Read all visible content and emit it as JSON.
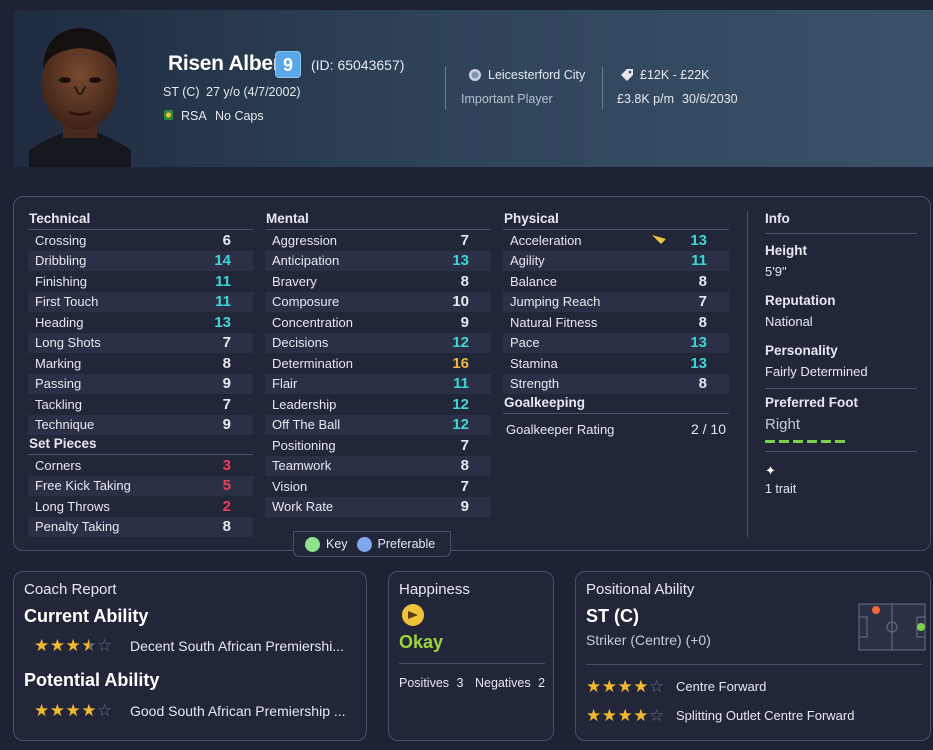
{
  "player": {
    "name": "Risen Albert",
    "number": "9",
    "id_text": "(ID: 65043657)",
    "position": "ST (C)",
    "age_dob": "27 y/o (4/7/2002)",
    "nation": "RSA",
    "caps": "No Caps",
    "club": "Leicesterford City",
    "squad_status": "Important Player",
    "value": "£12K - £22K",
    "wage": "£3.8K p/m",
    "contract_end": "30/6/2030"
  },
  "technical": {
    "title": "Technical",
    "rows": [
      {
        "label": "Crossing",
        "value": "6",
        "tone": "norm"
      },
      {
        "label": "Dribbling",
        "value": "14",
        "tone": "hi"
      },
      {
        "label": "Finishing",
        "value": "11",
        "tone": "hi"
      },
      {
        "label": "First Touch",
        "value": "11",
        "tone": "hi"
      },
      {
        "label": "Heading",
        "value": "13",
        "tone": "hi"
      },
      {
        "label": "Long Shots",
        "value": "7",
        "tone": "norm"
      },
      {
        "label": "Marking",
        "value": "8",
        "tone": "norm"
      },
      {
        "label": "Passing",
        "value": "9",
        "tone": "norm"
      },
      {
        "label": "Tackling",
        "value": "7",
        "tone": "norm"
      },
      {
        "label": "Technique",
        "value": "9",
        "tone": "norm"
      }
    ]
  },
  "set_pieces": {
    "title": "Set Pieces",
    "rows": [
      {
        "label": "Corners",
        "value": "3",
        "tone": "red"
      },
      {
        "label": "Free Kick Taking",
        "value": "5",
        "tone": "red"
      },
      {
        "label": "Long Throws",
        "value": "2",
        "tone": "red"
      },
      {
        "label": "Penalty Taking",
        "value": "8",
        "tone": "norm"
      }
    ]
  },
  "mental": {
    "title": "Mental",
    "rows": [
      {
        "label": "Aggression",
        "value": "7",
        "tone": "norm"
      },
      {
        "label": "Anticipation",
        "value": "13",
        "tone": "hi"
      },
      {
        "label": "Bravery",
        "value": "8",
        "tone": "norm"
      },
      {
        "label": "Composure",
        "value": "10",
        "tone": "norm"
      },
      {
        "label": "Concentration",
        "value": "9",
        "tone": "norm"
      },
      {
        "label": "Decisions",
        "value": "12",
        "tone": "hi"
      },
      {
        "label": "Determination",
        "value": "16",
        "tone": "or"
      },
      {
        "label": "Flair",
        "value": "11",
        "tone": "hi"
      },
      {
        "label": "Leadership",
        "value": "12",
        "tone": "hi"
      },
      {
        "label": "Off The Ball",
        "value": "12",
        "tone": "hi"
      },
      {
        "label": "Positioning",
        "value": "7",
        "tone": "norm"
      },
      {
        "label": "Teamwork",
        "value": "8",
        "tone": "norm"
      },
      {
        "label": "Vision",
        "value": "7",
        "tone": "norm"
      },
      {
        "label": "Work Rate",
        "value": "9",
        "tone": "norm"
      }
    ]
  },
  "physical": {
    "title": "Physical",
    "rows": [
      {
        "label": "Acceleration",
        "value": "13",
        "tone": "hi"
      },
      {
        "label": "Agility",
        "value": "11",
        "tone": "hi"
      },
      {
        "label": "Balance",
        "value": "8",
        "tone": "norm"
      },
      {
        "label": "Jumping Reach",
        "value": "7",
        "tone": "norm"
      },
      {
        "label": "Natural Fitness",
        "value": "8",
        "tone": "norm"
      },
      {
        "label": "Pace",
        "value": "13",
        "tone": "hi"
      },
      {
        "label": "Stamina",
        "value": "13",
        "tone": "hi"
      },
      {
        "label": "Strength",
        "value": "8",
        "tone": "norm"
      }
    ]
  },
  "goalkeeping": {
    "title": "Goalkeeping",
    "rating_label": "Goalkeeper Rating",
    "rating_value": "2 / 10"
  },
  "info": {
    "title": "Info",
    "height_label": "Height",
    "height_value": "5'9\"",
    "reputation_label": "Reputation",
    "reputation_value": "National",
    "personality_label": "Personality",
    "personality_value": "Fairly Determined",
    "foot_label": "Preferred Foot",
    "foot_value": "Right",
    "traits": "1 trait"
  },
  "legend": {
    "key_label": "Key",
    "preferable_label": "Preferable",
    "key_color": "#8fe08f",
    "preferable_color": "#7fa8f0"
  },
  "coach_report": {
    "title": "Coach Report",
    "current_title": "Current Ability",
    "current_stars": 3.5,
    "current_text": "Decent South African Premiershi...",
    "potential_title": "Potential Ability",
    "potential_stars": 4,
    "potential_text": "Good South African Premiership ..."
  },
  "happiness": {
    "title": "Happiness",
    "status": "Okay",
    "positives_label": "Positives",
    "positives_count": "3",
    "negatives_label": "Negatives",
    "negatives_count": "2"
  },
  "positional": {
    "title": "Positional Ability",
    "position": "ST (C)",
    "position_desc": "Striker (Centre) (+0)",
    "roles": [
      {
        "stars": 4,
        "name": "Centre Forward"
      },
      {
        "stars": 4,
        "name": "Splitting Outlet Centre Forward"
      }
    ]
  }
}
